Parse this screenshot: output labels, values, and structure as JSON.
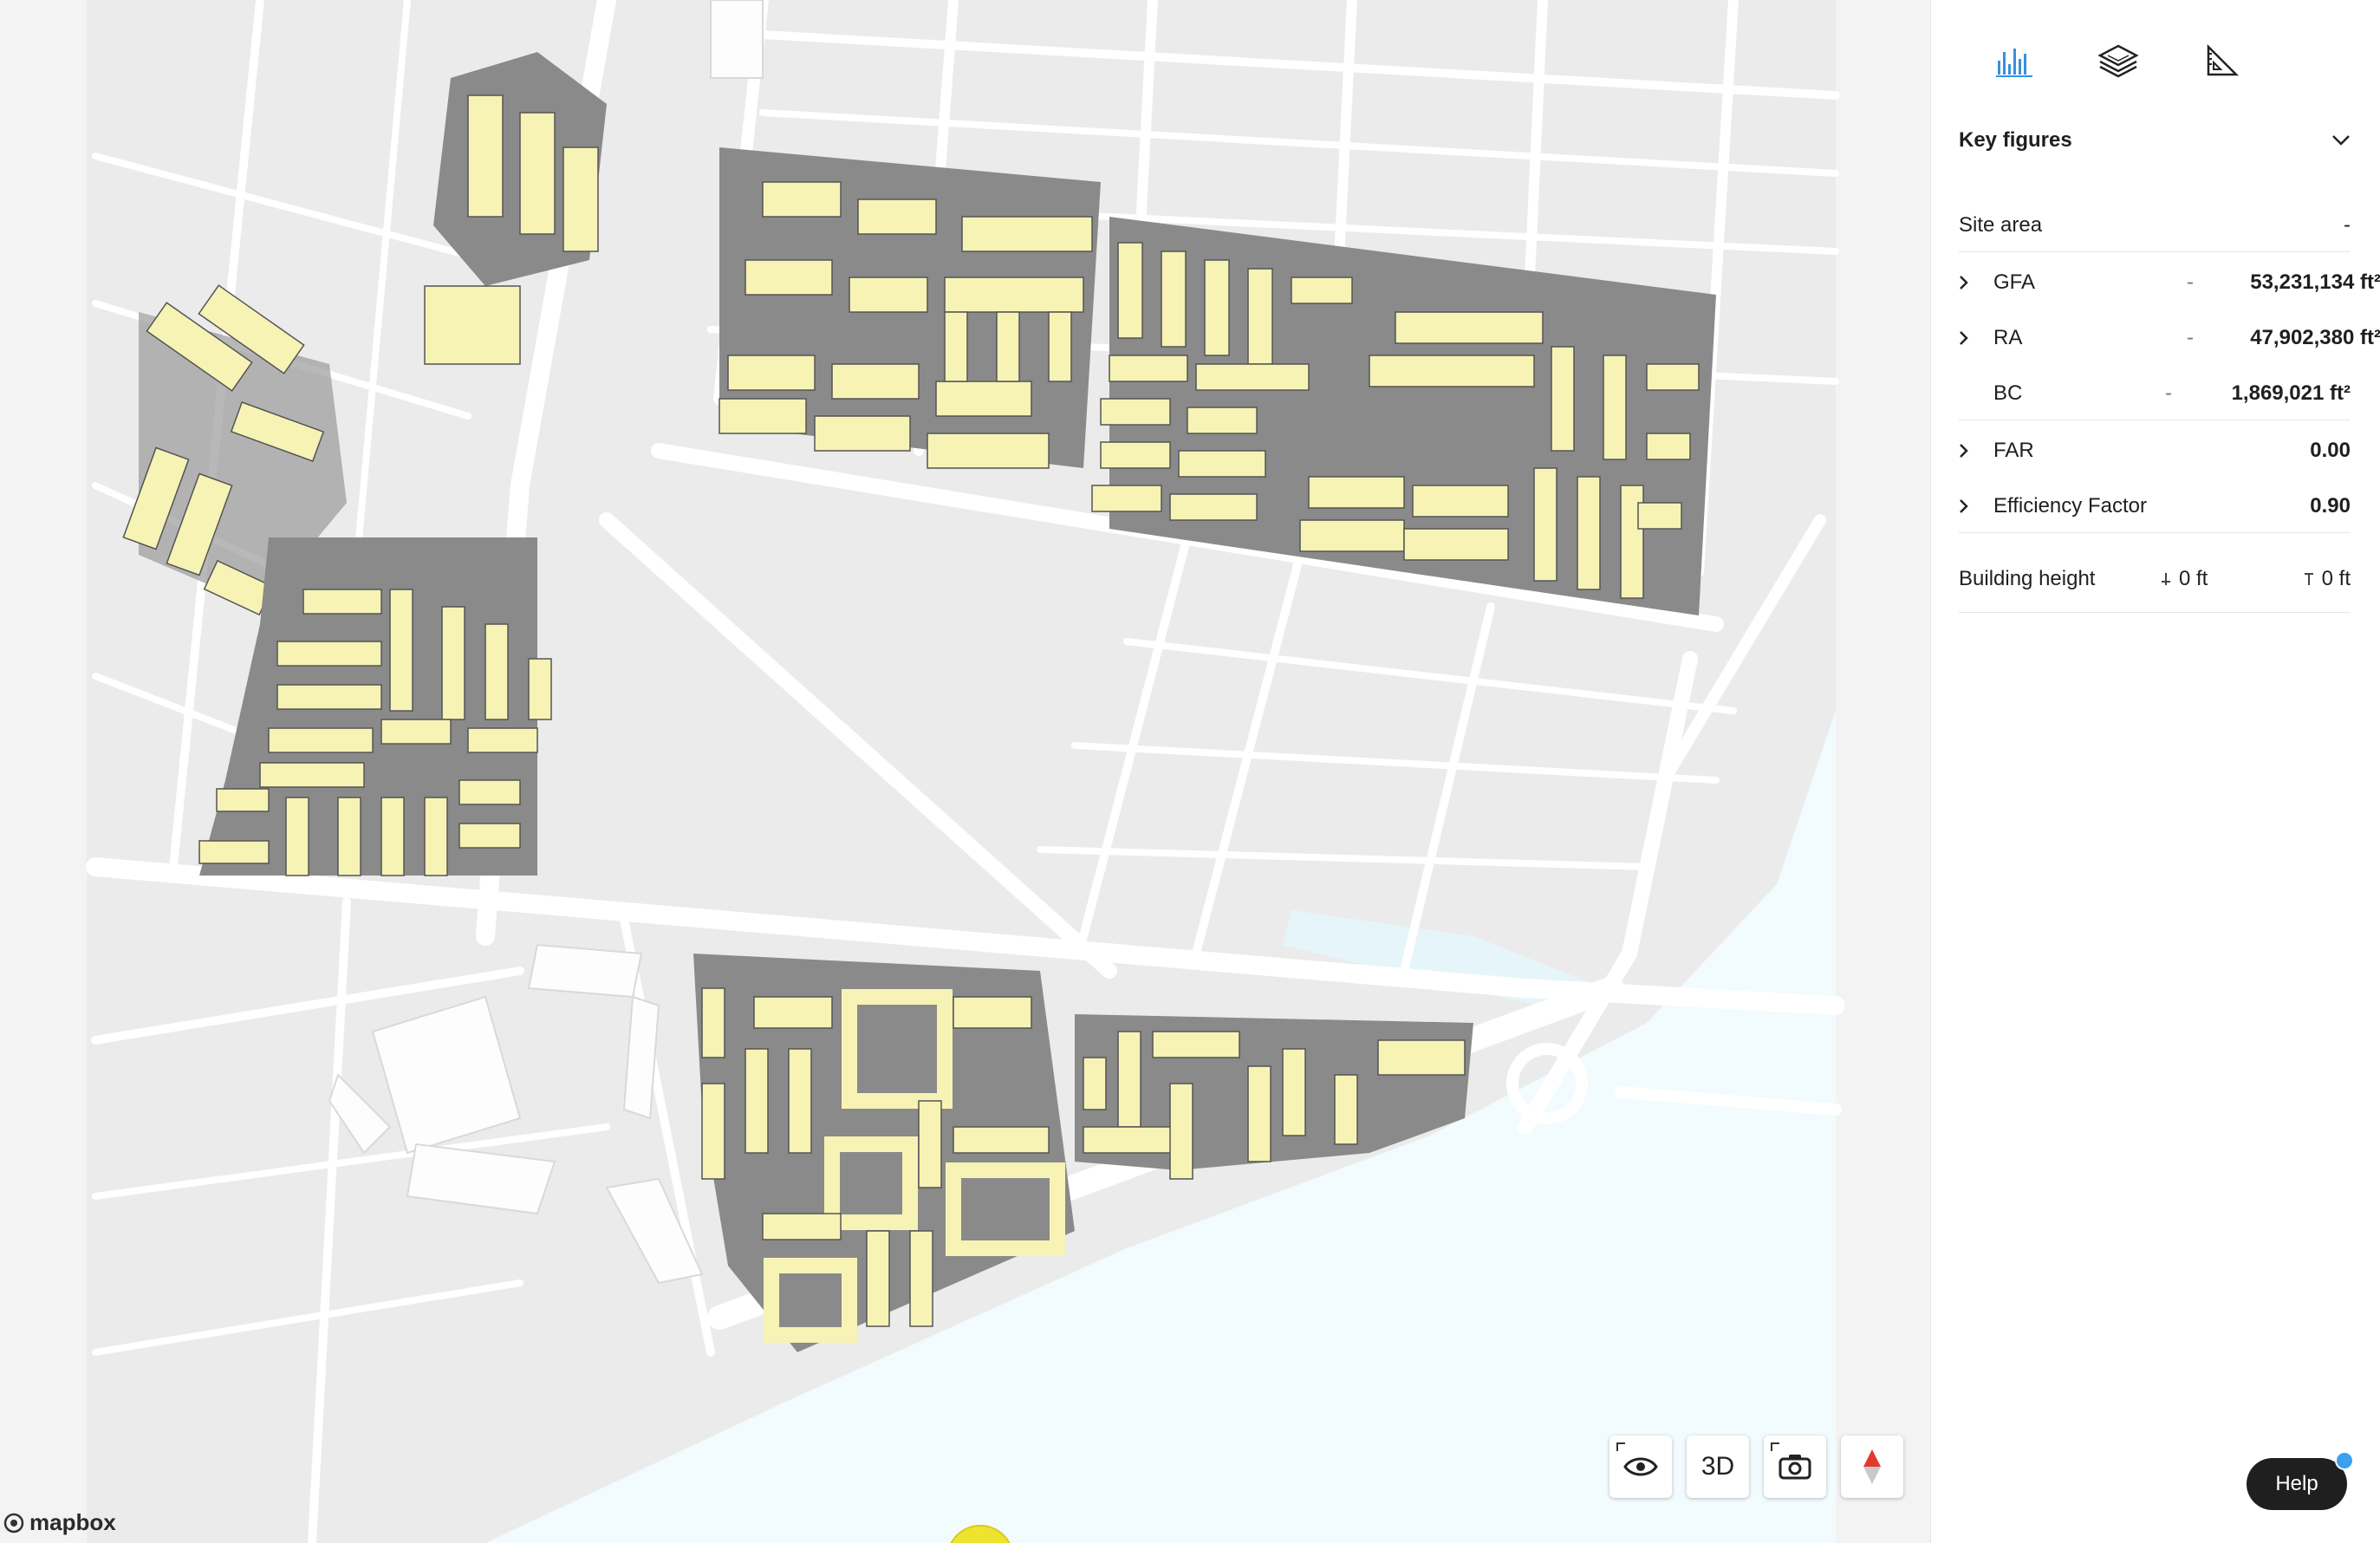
{
  "map": {
    "attribution": "mapbox",
    "controls": {
      "visibility_icon": "eye-icon",
      "view_mode_label": "3D",
      "screenshot_icon": "camera-icon",
      "compass_icon": "compass-icon"
    }
  },
  "panel": {
    "tabs": [
      {
        "icon": "bar-chart-icon",
        "active": true
      },
      {
        "icon": "layers-icon",
        "active": false
      },
      {
        "icon": "ruler-triangle-icon",
        "active": false
      }
    ],
    "section": {
      "title": "Key figures",
      "expanded": true
    },
    "rows": {
      "site_area": {
        "label": "Site area",
        "value": "-"
      },
      "gfa": {
        "label": "GFA",
        "dash": "-",
        "value": "53,231,134 ft²"
      },
      "ra": {
        "label": "RA",
        "dash": "-",
        "value": "47,902,380 ft²"
      },
      "bc": {
        "label": "BC",
        "dash": "-",
        "value": "1,869,021 ft²"
      },
      "far": {
        "label": "FAR",
        "value": "0.00"
      },
      "efficiency": {
        "label": "Efficiency Factor",
        "value": "0.90"
      },
      "building_height": {
        "label": "Building height",
        "min": "0 ft",
        "max": "0 ft"
      }
    }
  },
  "help": {
    "label": "Help"
  },
  "colors": {
    "accent": "#3a8fdc",
    "building_roof": "#f6f3b5",
    "building_side": "#7a7a7a",
    "water": "#f2fbfd",
    "road": "#ffffff"
  }
}
